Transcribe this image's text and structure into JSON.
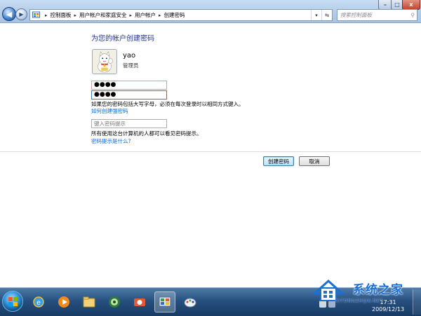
{
  "window": {
    "minimize_glyph": "–",
    "maximize_glyph": "□",
    "close_glyph": "x"
  },
  "address": {
    "breadcrumbs": [
      "控制面板",
      "用户帐户和家庭安全",
      "用户帐户",
      "创建密码"
    ],
    "search_placeholder": "搜索控制面板"
  },
  "page": {
    "title": "为您的帐户创建密码",
    "user": {
      "name": "yao",
      "role": "管理员"
    },
    "password_value": "●●●●",
    "confirm_value": "●●●●",
    "case_note": "如果您的密码包括大写字母，必须在每次登录时以相同方式键入。",
    "strong_link": "如何创建强密码",
    "hint_placeholder": "键入密码提示",
    "hint_note": "所有使用这台计算机的人都可以看见密码提示。",
    "hint_link": "密码提示是什么?",
    "create_button": "创建密码",
    "cancel_button": "取消"
  },
  "taskbar": {
    "apps": [
      "ie-icon",
      "media-player-icon",
      "explorer-icon",
      "media-center-icon",
      "camera-icon",
      "control-panel-icon",
      "paint-icon"
    ],
    "clock_time": "17:31",
    "clock_date": "2009/12/13"
  },
  "watermark": {
    "name": "系统之家",
    "sub": "XITONGZHIJIA.NET"
  },
  "colors": {
    "title_blue": "#1e3287",
    "link_blue": "#0a6ad6",
    "taskbar": "#27507f"
  }
}
